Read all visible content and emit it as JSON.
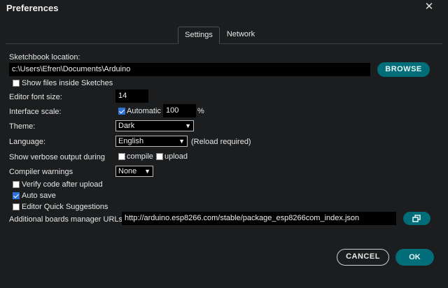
{
  "dialog": {
    "title": "Preferences"
  },
  "tabs": [
    {
      "label": "Settings"
    },
    {
      "label": "Network"
    }
  ],
  "sketchbook": {
    "label": "Sketchbook location:",
    "value": "c:\\Users\\Efren\\Documents\\Arduino",
    "browse_label": "BROWSE",
    "show_files_label": "Show files inside Sketches",
    "show_files_checked": false
  },
  "font_size": {
    "label": "Editor font size:",
    "value": "14"
  },
  "interface_scale": {
    "label": "Interface scale:",
    "automatic_label": "Automatic",
    "automatic_checked": true,
    "value": "100",
    "unit": "%"
  },
  "theme": {
    "label": "Theme:",
    "selected": "Dark"
  },
  "language": {
    "label": "Language:",
    "selected": "English",
    "note": "(Reload required)"
  },
  "verbose": {
    "label": "Show verbose output during",
    "compile_label": "compile",
    "compile_checked": false,
    "upload_label": "upload",
    "upload_checked": false
  },
  "compiler_warnings": {
    "label": "Compiler warnings",
    "selected": "None"
  },
  "options": {
    "verify_label": "Verify code after upload",
    "verify_checked": false,
    "autosave_label": "Auto save",
    "autosave_checked": true,
    "quick_suggestions_label": "Editor Quick Suggestions",
    "quick_suggestions_checked": false
  },
  "boards_urls": {
    "label": "Additional boards manager URLs:",
    "value": "http://arduino.esp8266.com/stable/package_esp8266com_index.json",
    "icon": "open-window-icon"
  },
  "footer": {
    "cancel_label": "CANCEL",
    "ok_label": "OK"
  },
  "colors": {
    "background": "#1b1d1f",
    "accent": "#006d78",
    "checkbox_on": "#2f72d8"
  }
}
